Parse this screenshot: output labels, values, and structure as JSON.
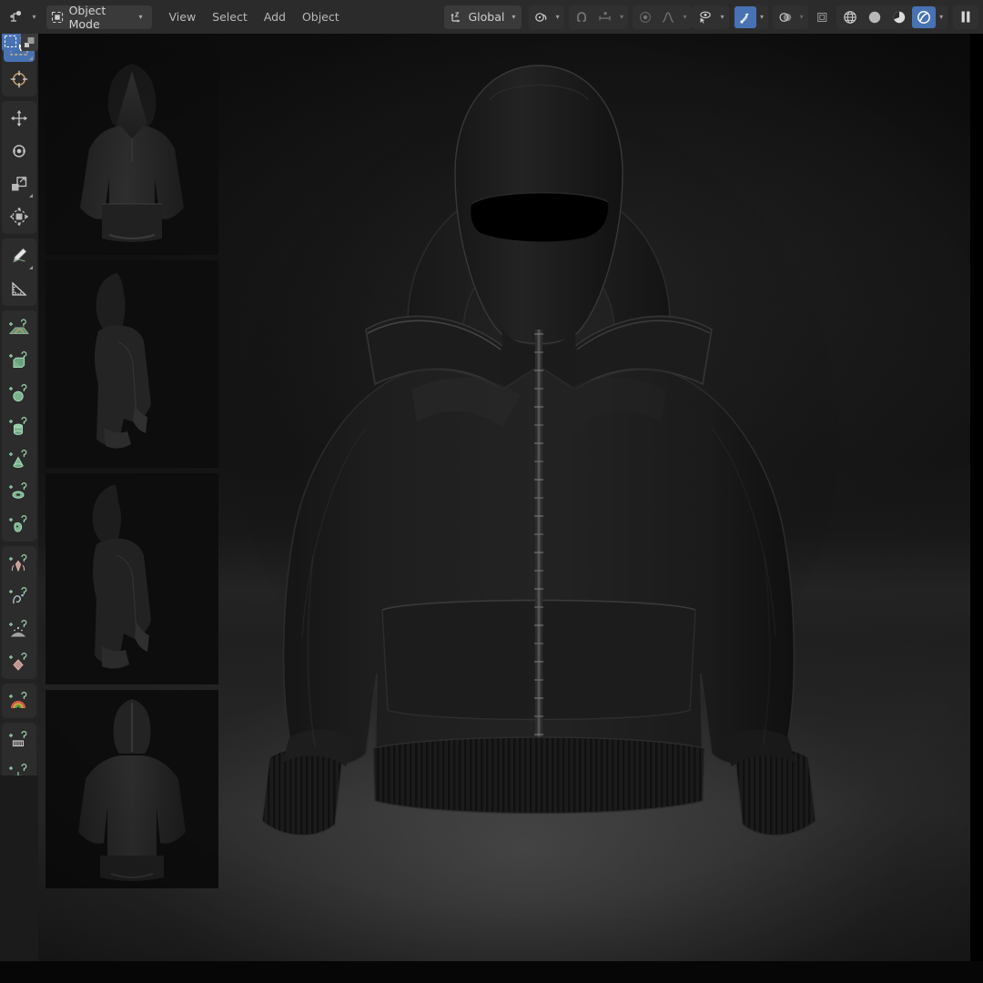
{
  "app": {
    "name": "Blender 3D Viewport",
    "accent_blue": "#4772b3",
    "header_bg": "#2b2b2b",
    "toolbar_bg": "#232323",
    "viewport_bg": "#101010"
  },
  "header": {
    "editor_type": {
      "name": "editor-type-selector",
      "icon": "editor-type-icon",
      "label": ""
    },
    "mode": {
      "label": "Object Mode",
      "icon": "object-mode-icon",
      "caret": "▾"
    },
    "menus": [
      {
        "name": "view",
        "label": "View"
      },
      {
        "name": "select",
        "label": "Select"
      },
      {
        "name": "add",
        "label": "Add"
      },
      {
        "name": "object",
        "label": "Object"
      }
    ],
    "transform_orientation": {
      "label": "Global",
      "icon": "orientation-axes-icon",
      "caret": "▾"
    },
    "pivot": {
      "name": "pivot-point",
      "icon": "pivot-median-icon",
      "caret": "▾"
    },
    "snap": {
      "name": "snap-magnet",
      "icon": "magnet-icon",
      "enabled": false
    },
    "snap_target": {
      "name": "snap-target",
      "icon": "snap-increment-icon",
      "caret": "▾"
    },
    "proportional": {
      "name": "proportional-editing",
      "icon": "proportional-dot-icon",
      "enabled": false
    },
    "falloff": {
      "name": "proportional-falloff",
      "icon": "falloff-curve-icon",
      "caret": "▾"
    },
    "visibility": {
      "name": "object-visibility",
      "icon": "eye-cursor-icon",
      "caret": "▾"
    },
    "gizmos": {
      "name": "show-gizmo",
      "icon": "gizmo-icon",
      "enabled": true,
      "caret": "▾"
    },
    "overlays": {
      "name": "show-overlays",
      "icon": "overlays-icon",
      "enabled": false,
      "caret": "▾"
    },
    "xray": {
      "name": "toggle-xray",
      "icon": "xray-icon",
      "enabled": false
    },
    "shading_modes": [
      {
        "name": "shading-wireframe",
        "icon": "wireframe-globe-icon",
        "selected": false
      },
      {
        "name": "shading-solid",
        "icon": "solid-sphere-icon",
        "selected": false
      },
      {
        "name": "shading-material-preview",
        "icon": "material-preview-icon",
        "selected": false
      },
      {
        "name": "shading-rendered",
        "icon": "rendered-sphere-icon",
        "selected": true
      }
    ],
    "shading_caret": "▾",
    "pause_render": {
      "name": "pause-viewport-render",
      "icon": "pause-icon"
    }
  },
  "select_widget": {
    "box_select": {
      "name": "box-select-mode",
      "icon": "box-select-icon",
      "active": true
    },
    "object_select": {
      "name": "object-select-mode",
      "icon": "object-select-icon",
      "active": false
    }
  },
  "toolbar": {
    "groups": [
      {
        "name": "select-transform-group",
        "tools": [
          {
            "name": "tool-tweak-select",
            "icon": "cursor-arrow-select-icon",
            "active": true,
            "has_submenu": true
          },
          {
            "name": "tool-cursor",
            "icon": "3d-cursor-icon",
            "active": false,
            "has_submenu": false
          }
        ]
      },
      {
        "name": "transform-group",
        "tools": [
          {
            "name": "tool-move",
            "icon": "move-arrows-icon",
            "active": false,
            "has_submenu": false
          },
          {
            "name": "tool-rotate",
            "icon": "rotate-icon",
            "active": false,
            "has_submenu": false
          },
          {
            "name": "tool-scale",
            "icon": "scale-icon",
            "active": false,
            "has_submenu": true
          },
          {
            "name": "tool-transform",
            "icon": "transform-icon",
            "active": false,
            "has_submenu": false
          }
        ]
      },
      {
        "name": "annotate-measure-group",
        "tools": [
          {
            "name": "tool-annotate",
            "icon": "annotate-pencil-icon",
            "active": false,
            "has_submenu": true
          },
          {
            "name": "tool-measure",
            "icon": "measure-ruler-icon",
            "active": false,
            "has_submenu": false
          }
        ]
      },
      {
        "name": "add-primitive-group",
        "tools": [
          {
            "name": "tool-add-plane",
            "icon": "add-plane-icon",
            "active": false,
            "has_submenu": false
          },
          {
            "name": "tool-add-cube",
            "icon": "add-cube-icon",
            "active": false,
            "has_submenu": false
          },
          {
            "name": "tool-add-sphere",
            "icon": "add-uv-sphere-icon",
            "active": false,
            "has_submenu": false
          },
          {
            "name": "tool-add-cylinder",
            "icon": "add-cylinder-icon",
            "active": false,
            "has_submenu": false
          },
          {
            "name": "tool-add-cone",
            "icon": "add-cone-icon",
            "active": false,
            "has_submenu": false
          },
          {
            "name": "tool-add-torus",
            "icon": "add-torus-icon",
            "active": false,
            "has_submenu": false
          },
          {
            "name": "tool-add-monkey",
            "icon": "add-monkey-icon",
            "active": false,
            "has_submenu": false
          }
        ]
      },
      {
        "name": "add-object-group",
        "tools": [
          {
            "name": "tool-add-armature",
            "icon": "add-armature-icon",
            "active": false,
            "has_submenu": false
          },
          {
            "name": "tool-add-curve",
            "icon": "add-curve-icon",
            "active": false,
            "has_submenu": false
          },
          {
            "name": "tool-add-particles",
            "icon": "add-particles-icon",
            "active": false,
            "has_submenu": false
          },
          {
            "name": "tool-add-force-field",
            "icon": "add-force-field-icon",
            "active": false,
            "has_submenu": false
          }
        ]
      },
      {
        "name": "add-light-group",
        "tools": [
          {
            "name": "tool-add-light-probe",
            "icon": "add-light-probe-icon",
            "active": false,
            "has_submenu": false
          }
        ]
      },
      {
        "name": "add-misc-group",
        "tools": [
          {
            "name": "tool-add-text",
            "icon": "add-text-icon",
            "active": false,
            "has_submenu": false
          },
          {
            "name": "tool-add-empty",
            "icon": "add-empty-icon",
            "active": false,
            "has_submenu": false
          }
        ]
      }
    ]
  },
  "viewport": {
    "name": "3d-viewport",
    "shading": "Rendered",
    "scene_description": "Dark studio render of an oversized hooded zip-up jacket worn with a black balaclava",
    "reference_thumbnails": [
      {
        "name": "thumbnail-hoodie-front",
        "label": "Front view hoodie",
        "view": "front"
      },
      {
        "name": "thumbnail-hoodie-side-a",
        "label": "Side view hoodie",
        "view": "side"
      },
      {
        "name": "thumbnail-hoodie-side-b",
        "label": "Three-quarter side hoodie",
        "view": "three-quarter"
      },
      {
        "name": "thumbnail-hoodie-back",
        "label": "Back view hoodie",
        "view": "back"
      }
    ],
    "main_object": {
      "name": "zip-hoodie-with-balaclava",
      "parts": [
        "balaclava-mask",
        "hood",
        "zipper",
        "kangaroo-pocket",
        "ribbed-hem",
        "ribbed-cuffs",
        "sleeves"
      ]
    }
  }
}
